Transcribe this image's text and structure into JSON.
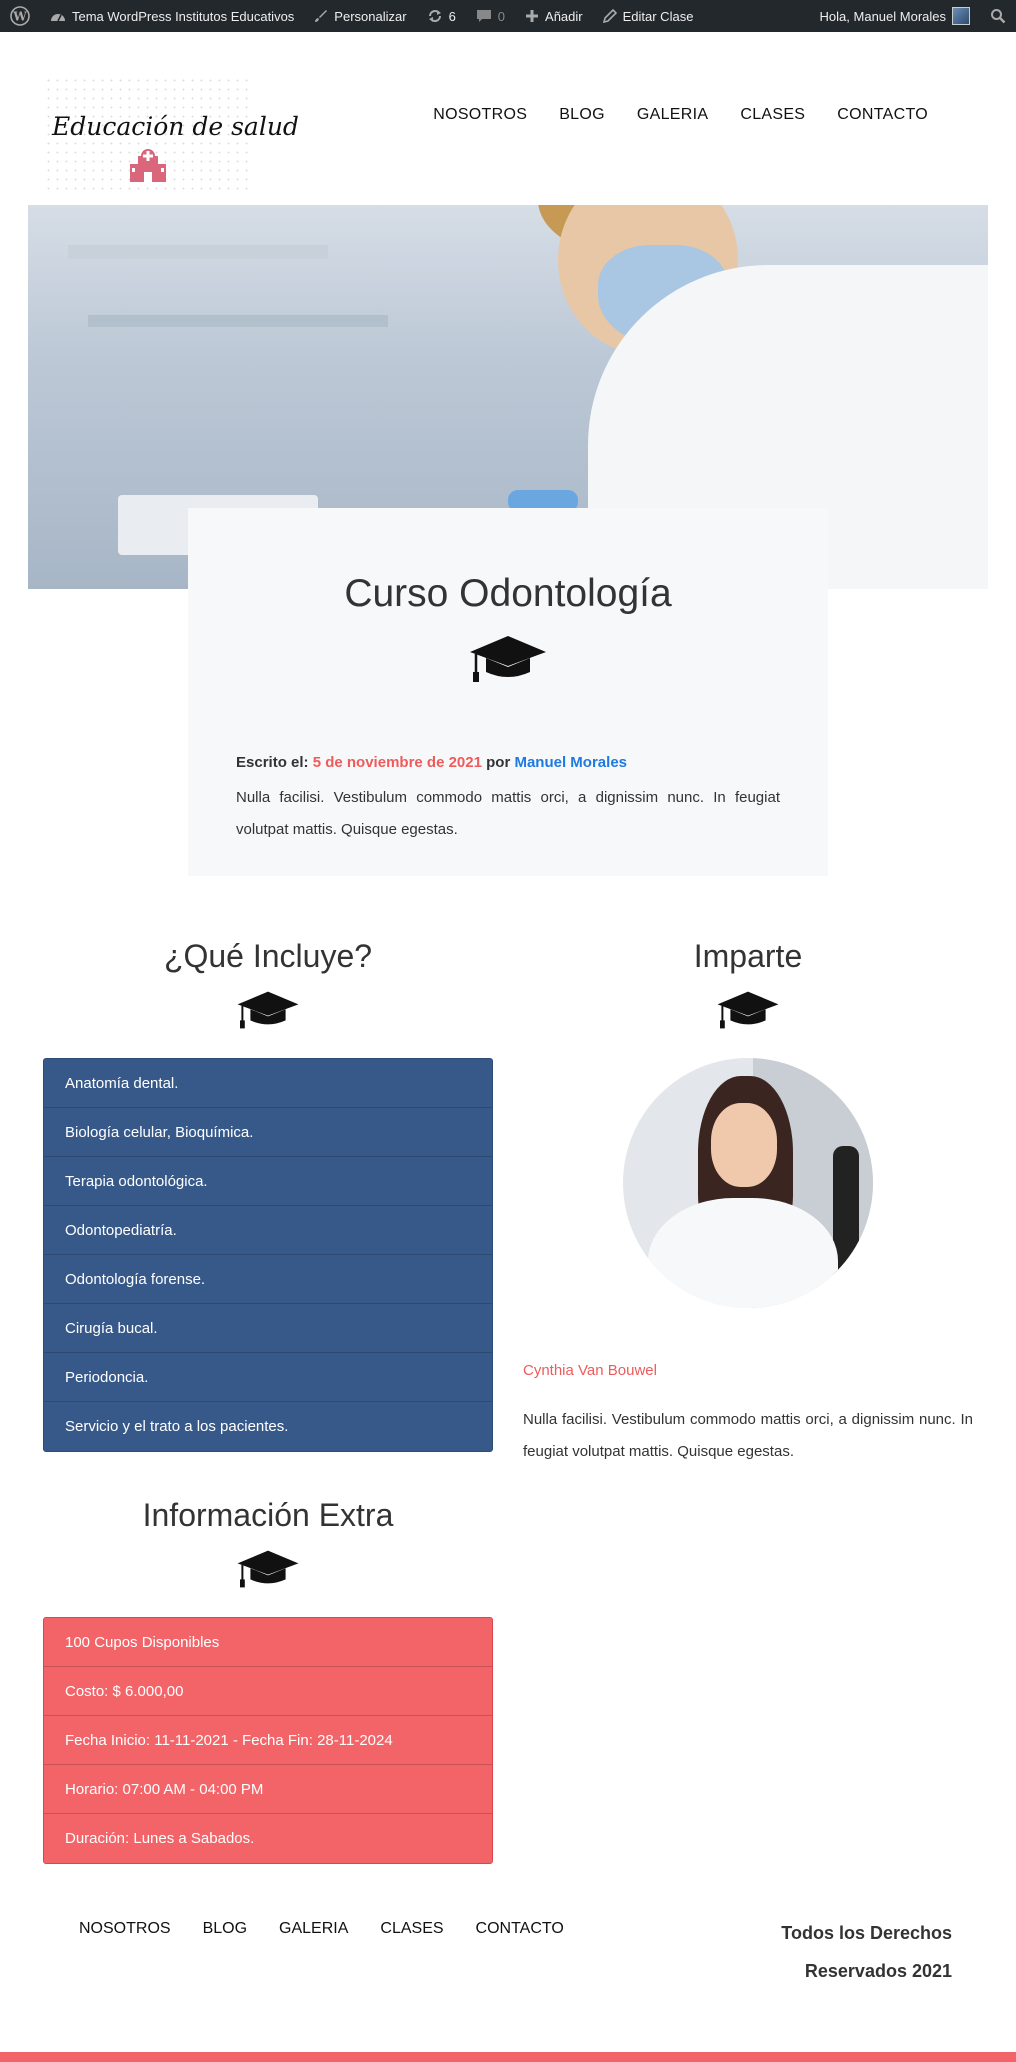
{
  "adminbar": {
    "site_name": "Tema WordPress Institutos Educativos",
    "customize": "Personalizar",
    "updates_count": "6",
    "comments_count": "0",
    "add_new": "Añadir",
    "edit": "Editar Clase",
    "greeting": "Hola, Manuel Morales"
  },
  "header": {
    "logo_text": "Educación de salud",
    "nav": [
      "NOSOTROS",
      "BLOG",
      "GALERIA",
      "CLASES",
      "CONTACTO"
    ]
  },
  "post": {
    "title": "Curso Odontología",
    "written_label": "Escrito el:",
    "date": "5 de noviembre de 2021",
    "by_label": "por",
    "author": "Manuel Morales",
    "excerpt": "Nulla facilisi. Vestibulum commodo mattis orci, a dignissim nunc. In feugiat volutpat mattis. Quisque egestas."
  },
  "includes": {
    "title": "¿Qué Incluye?",
    "items": [
      "Anatomía dental.",
      "Biología celular, Bioquímica.",
      "Terapia odontológica.",
      "Odontopediatría.",
      "Odontología forense.",
      "Cirugía bucal.",
      "Periodoncia.",
      "Servicio y el trato a los pacientes."
    ]
  },
  "teacher": {
    "title": "Imparte",
    "name": "Cynthia Van Bouwel",
    "bio": "Nulla facilisi. Vestibulum commodo mattis orci, a dignissim nunc. In feugiat volutpat mattis. Quisque egestas."
  },
  "extra": {
    "title": "Información Extra",
    "items": [
      "100 Cupos Disponibles",
      "Costo: $ 6.000,00",
      "Fecha Inicio: 11-11-2021 - Fecha Fin: 28-11-2024",
      "Horario: 07:00 AM - 04:00 PM",
      "Duración: Lunes a Sabados."
    ]
  },
  "footer": {
    "nav": [
      "NOSOTROS",
      "BLOG",
      "GALERIA",
      "CLASES",
      "CONTACTO"
    ],
    "rights_line1": "Todos los Derechos",
    "rights_line2": "Reservados 2021"
  },
  "colors": {
    "accent_red": "#f36469",
    "list_blue": "#37598a",
    "link_blue": "#1e7ae0",
    "adminbar": "#23282d"
  },
  "icons": [
    "wordpress-icon",
    "dashboard-icon",
    "brush-icon",
    "updates-icon",
    "comment-icon",
    "plus-icon",
    "pencil-icon",
    "search-icon",
    "graduation-cap-icon",
    "school-icon"
  ]
}
